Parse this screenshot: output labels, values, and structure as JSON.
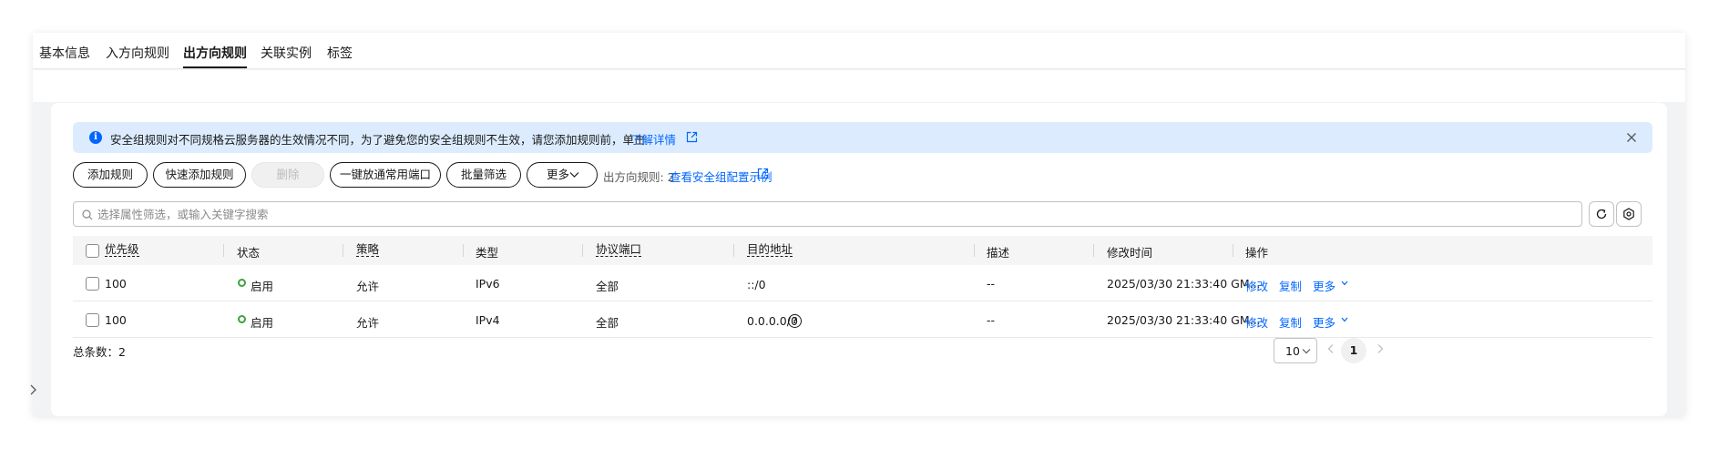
{
  "tabs": [
    {
      "label": "基本信息"
    },
    {
      "label": "入方向规则"
    },
    {
      "label": "出方向规则",
      "active": true
    },
    {
      "label": "关联实例"
    },
    {
      "label": "标签"
    }
  ],
  "alert": {
    "text": "安全组规则对不同规格云服务器的生效情况不同，为了避免您的安全组规则不生效，请您添加规则前，单击",
    "link": "了解详情"
  },
  "toolbar": {
    "add_rule": "添加规则",
    "quick_add": "快速添加规则",
    "delete": "删除",
    "one_click": "一键放通常用端口",
    "batch_filter": "批量筛选",
    "more": "更多",
    "rule_count_label": "出方向规则: 2",
    "example_link": "查看安全组配置示例"
  },
  "search": {
    "placeholder": "选择属性筛选，或输入关键字搜索"
  },
  "table": {
    "headers": {
      "priority": "优先级",
      "status": "状态",
      "policy": "策略",
      "type": "类型",
      "protocol_port": "协议端口",
      "destination": "目的地址",
      "description": "描述",
      "modified": "修改时间",
      "actions": "操作"
    },
    "rows": [
      {
        "priority": "100",
        "status": "启用",
        "policy": "允许",
        "type": "IPv6",
        "protocol_port": "全部",
        "destination": "::/0",
        "description": "--",
        "modified": "2025/03/30 21:33:40 GM...",
        "edit": "修改",
        "copy": "复制",
        "more": "更多"
      },
      {
        "priority": "100",
        "status": "启用",
        "policy": "允许",
        "type": "IPv4",
        "protocol_port": "全部",
        "destination": "0.0.0.0/0",
        "description": "--",
        "modified": "2025/03/30 21:33:40 GM...",
        "edit": "修改",
        "copy": "复制",
        "more": "更多"
      }
    ]
  },
  "footer": {
    "total": "总条数：2",
    "page_size": "10",
    "current_page": "1"
  },
  "colors": {
    "link": "#0066ff",
    "alert_bg": "#dcecfe",
    "status_enabled": "#3da33b"
  }
}
